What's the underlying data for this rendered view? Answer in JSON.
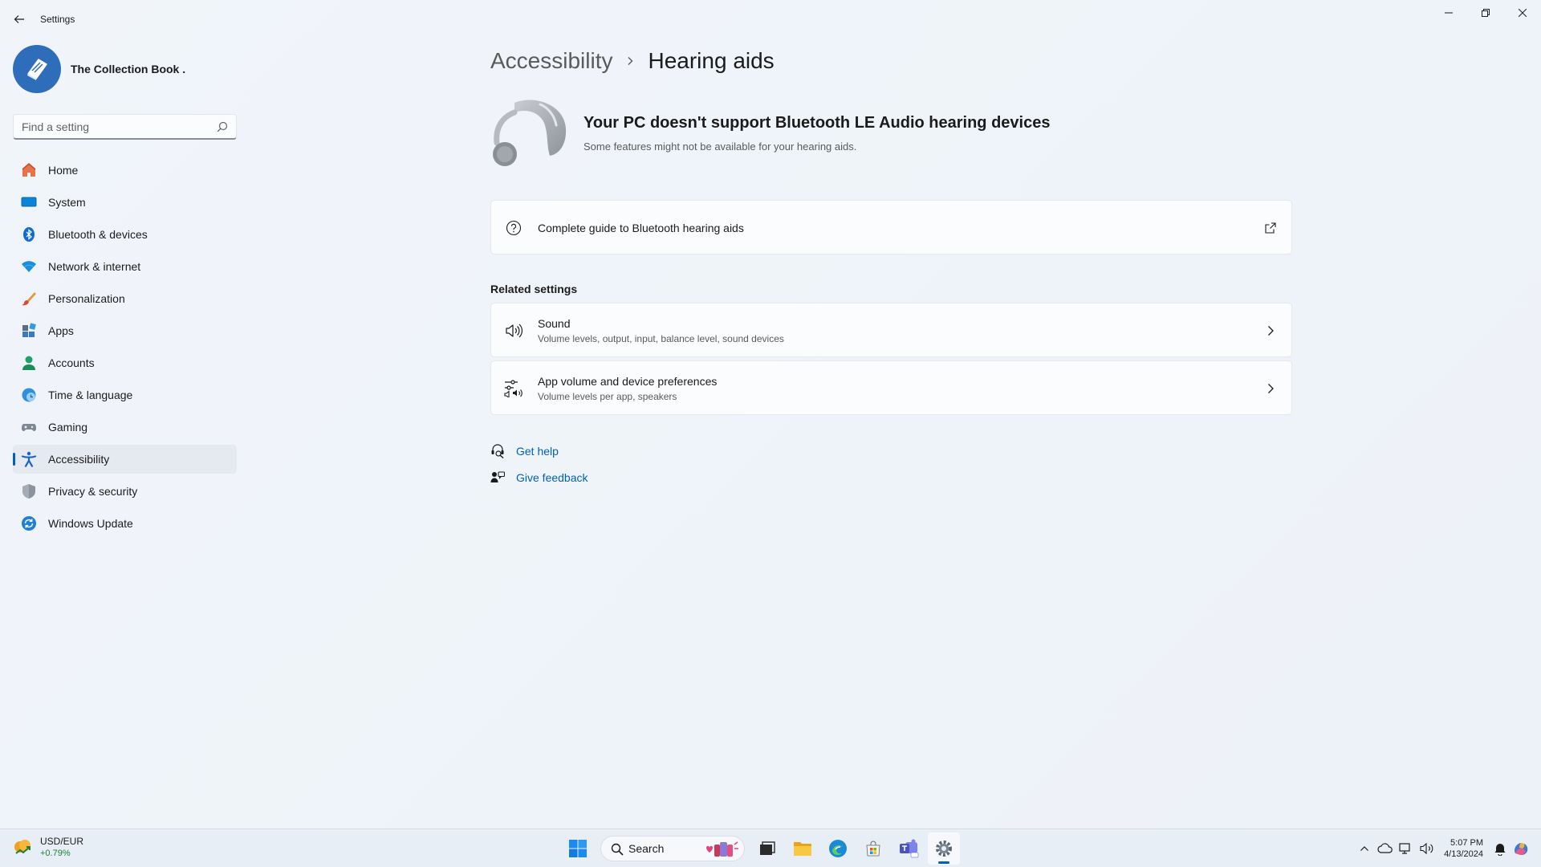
{
  "window": {
    "app_title": "Settings"
  },
  "profile": {
    "name": "The Collection Book ."
  },
  "search": {
    "placeholder": "Find a setting"
  },
  "sidebar": {
    "items": [
      {
        "label": "Home",
        "icon": "home-icon"
      },
      {
        "label": "System",
        "icon": "system-icon"
      },
      {
        "label": "Bluetooth & devices",
        "icon": "bluetooth-icon"
      },
      {
        "label": "Network & internet",
        "icon": "wifi-icon"
      },
      {
        "label": "Personalization",
        "icon": "brush-icon"
      },
      {
        "label": "Apps",
        "icon": "apps-icon"
      },
      {
        "label": "Accounts",
        "icon": "accounts-icon"
      },
      {
        "label": "Time & language",
        "icon": "time-language-icon"
      },
      {
        "label": "Gaming",
        "icon": "gaming-icon"
      },
      {
        "label": "Accessibility",
        "icon": "accessibility-icon",
        "active": true
      },
      {
        "label": "Privacy & security",
        "icon": "shield-icon"
      },
      {
        "label": "Windows Update",
        "icon": "windows-update-icon"
      }
    ]
  },
  "breadcrumb": {
    "parent": "Accessibility",
    "current": "Hearing aids"
  },
  "hero": {
    "title": "Your PC doesn't support Bluetooth LE Audio hearing devices",
    "subtitle": "Some features might not be available for your hearing aids."
  },
  "guide_card": {
    "label": "Complete guide to Bluetooth hearing aids"
  },
  "related": {
    "title": "Related settings",
    "items": [
      {
        "title": "Sound",
        "subtitle": "Volume levels, output, input, balance level, sound devices"
      },
      {
        "title": "App volume and device preferences",
        "subtitle": "Volume levels per app, speakers"
      }
    ]
  },
  "help": {
    "get_help": "Get help",
    "give_feedback": "Give feedback"
  },
  "taskbar": {
    "widget_title": "USD/EUR",
    "widget_change": "+0.79%",
    "search_label": "Search",
    "time": "5:07 PM",
    "date": "4/13/2024"
  },
  "colors": {
    "accent": "#005fb8",
    "background": "#eef3f9",
    "card": "#fbfcfd"
  }
}
